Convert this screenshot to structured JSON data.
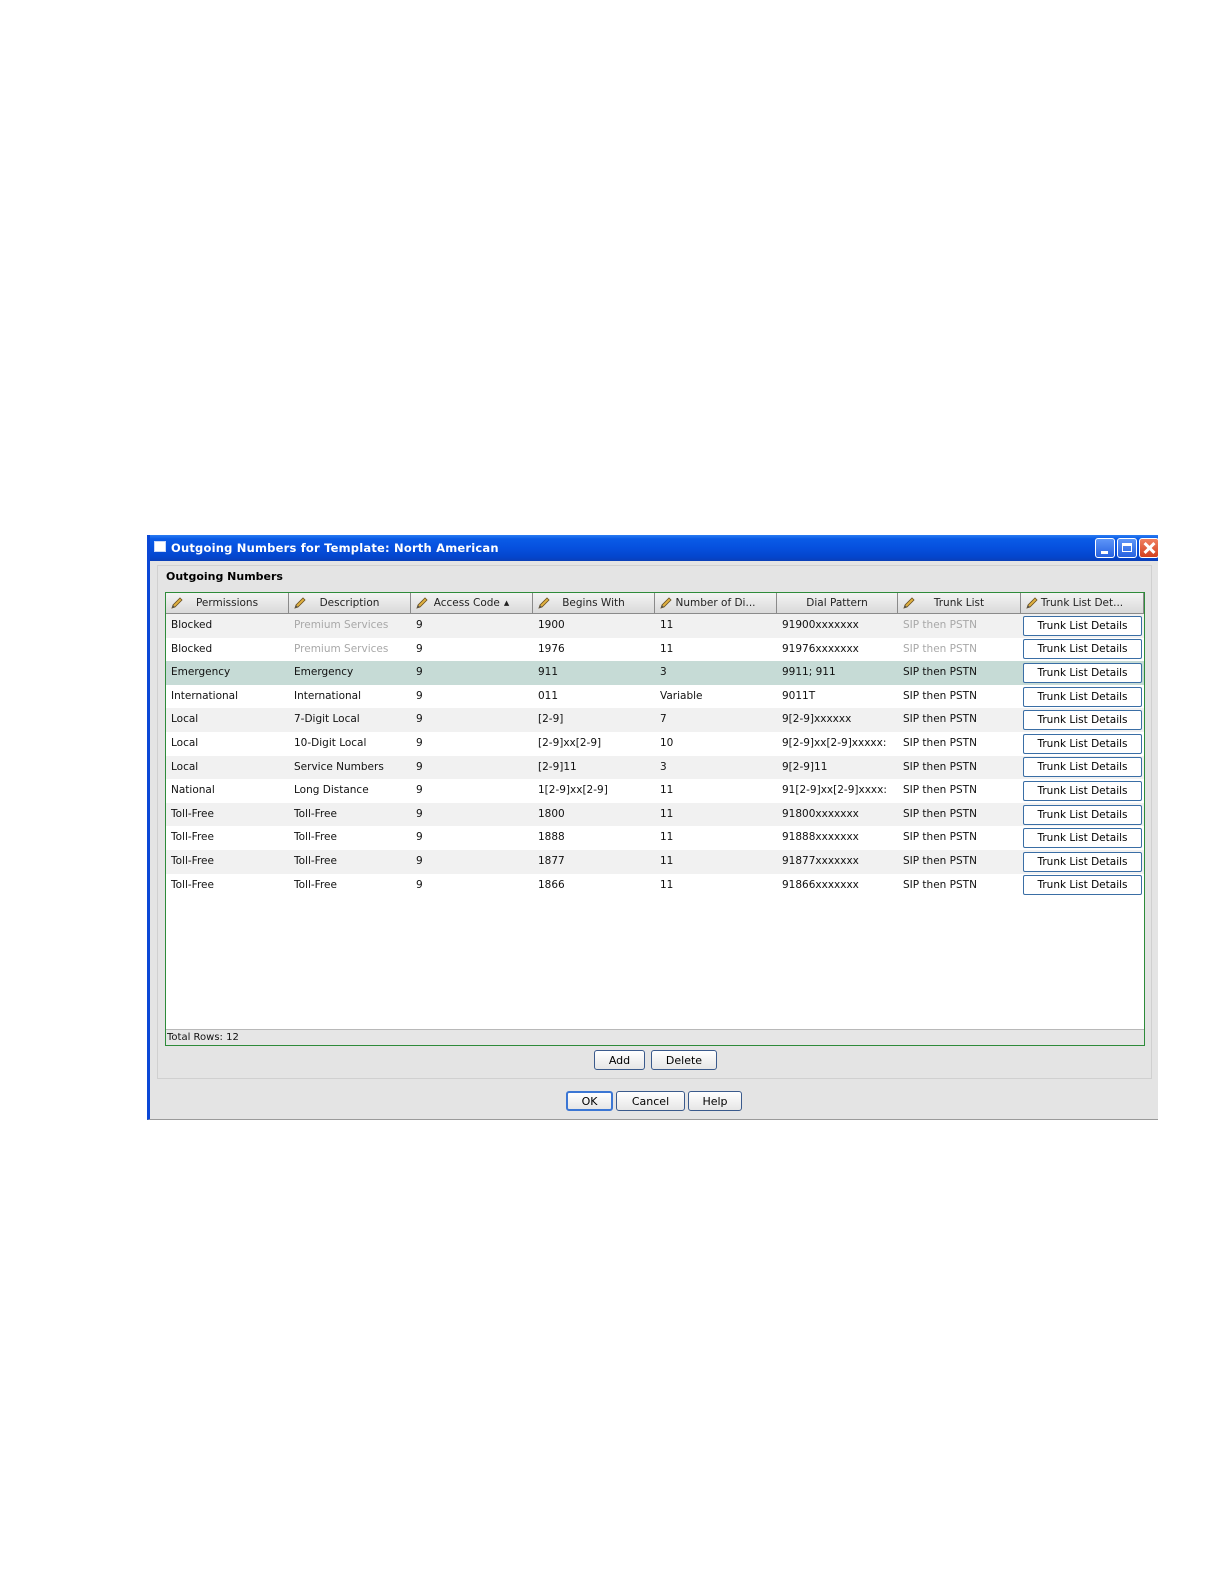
{
  "window": {
    "title": "Outgoing Numbers for Template: North American"
  },
  "panel": {
    "title": "Outgoing Numbers"
  },
  "table": {
    "columns": [
      {
        "label": "Permissions",
        "editable": true
      },
      {
        "label": "Description",
        "editable": true
      },
      {
        "label": "Access Code",
        "editable": true,
        "sort": "▲"
      },
      {
        "label": "Begins With",
        "editable": true
      },
      {
        "label": "Number of Di...",
        "editable": true
      },
      {
        "label": "Dial Pattern",
        "editable": false
      },
      {
        "label": "Trunk List",
        "editable": true
      },
      {
        "label": "Trunk List Det...",
        "editable": true
      }
    ],
    "rows": [
      {
        "permissions": "Blocked",
        "description": "Premium Services",
        "access_code": "9",
        "begins_with": "1900",
        "digits": "11",
        "dial_pattern": "91900xxxxxxx",
        "trunk_list": "SIP then PSTN",
        "details": "Trunk List Details",
        "dimmed": true
      },
      {
        "permissions": "Blocked",
        "description": "Premium Services",
        "access_code": "9",
        "begins_with": "1976",
        "digits": "11",
        "dial_pattern": "91976xxxxxxx",
        "trunk_list": "SIP then PSTN",
        "details": "Trunk List Details",
        "dimmed": true
      },
      {
        "permissions": "Emergency",
        "description": "Emergency",
        "access_code": "9",
        "begins_with": "911",
        "digits": "3",
        "dial_pattern": "9911; 911",
        "trunk_list": "SIP then PSTN",
        "details": "Trunk List Details",
        "selected": true
      },
      {
        "permissions": "International",
        "description": "International",
        "access_code": "9",
        "begins_with": "011",
        "digits": "Variable",
        "dial_pattern": "9011T",
        "trunk_list": "SIP then PSTN",
        "details": "Trunk List Details"
      },
      {
        "permissions": "Local",
        "description": "7-Digit Local",
        "access_code": "9",
        "begins_with": "[2-9]",
        "digits": "7",
        "dial_pattern": "9[2-9]xxxxxx",
        "trunk_list": "SIP then PSTN",
        "details": "Trunk List Details"
      },
      {
        "permissions": "Local",
        "description": "10-Digit Local",
        "access_code": "9",
        "begins_with": "[2-9]xx[2-9]",
        "digits": "10",
        "dial_pattern": "9[2-9]xx[2-9]xxxxx:",
        "trunk_list": "SIP then PSTN",
        "details": "Trunk List Details"
      },
      {
        "permissions": "Local",
        "description": "Service Numbers",
        "access_code": "9",
        "begins_with": "[2-9]11",
        "digits": "3",
        "dial_pattern": "9[2-9]11",
        "trunk_list": "SIP then PSTN",
        "details": "Trunk List Details"
      },
      {
        "permissions": "National",
        "description": "Long Distance",
        "access_code": "9",
        "begins_with": "1[2-9]xx[2-9]",
        "digits": "11",
        "dial_pattern": "91[2-9]xx[2-9]xxxx:",
        "trunk_list": "SIP then PSTN",
        "details": "Trunk List Details"
      },
      {
        "permissions": "Toll-Free",
        "description": "Toll-Free",
        "access_code": "9",
        "begins_with": "1800",
        "digits": "11",
        "dial_pattern": "91800xxxxxxx",
        "trunk_list": "SIP then PSTN",
        "details": "Trunk List Details"
      },
      {
        "permissions": "Toll-Free",
        "description": "Toll-Free",
        "access_code": "9",
        "begins_with": "1888",
        "digits": "11",
        "dial_pattern": "91888xxxxxxx",
        "trunk_list": "SIP then PSTN",
        "details": "Trunk List Details"
      },
      {
        "permissions": "Toll-Free",
        "description": "Toll-Free",
        "access_code": "9",
        "begins_with": "1877",
        "digits": "11",
        "dial_pattern": "91877xxxxxxx",
        "trunk_list": "SIP then PSTN",
        "details": "Trunk List Details"
      },
      {
        "permissions": "Toll-Free",
        "description": "Toll-Free",
        "access_code": "9",
        "begins_with": "1866",
        "digits": "11",
        "dial_pattern": "91866xxxxxxx",
        "trunk_list": "SIP then PSTN",
        "details": "Trunk List Details"
      }
    ],
    "total_rows": "Total Rows: 12"
  },
  "actions": {
    "add": "Add",
    "delete": "Delete"
  },
  "dialog_buttons": {
    "ok": "OK",
    "cancel": "Cancel",
    "help": "Help"
  },
  "colors": {
    "title_bar": "#0650de",
    "table_border": "#2e8b3a",
    "selected_row": "#c6dbd6"
  }
}
